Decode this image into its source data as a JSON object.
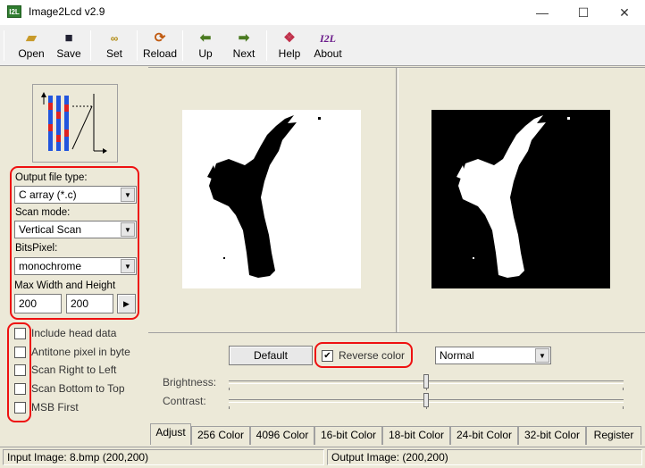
{
  "window": {
    "title": "Image2Lcd v2.9",
    "app_icon_text": "I2L",
    "minimize_glyph": "—",
    "maximize_glyph": "☐",
    "close_glyph": "✕"
  },
  "toolbar": {
    "items": [
      {
        "label": "Open",
        "icon": "folder-open-icon"
      },
      {
        "label": "Save",
        "icon": "floppy-save-icon"
      },
      {
        "label": "Set",
        "icon": "glasses-settings-icon"
      },
      {
        "label": "Reload",
        "icon": "reload-icon"
      },
      {
        "label": "Up",
        "icon": "arrow-left-icon"
      },
      {
        "label": "Next",
        "icon": "arrow-right-icon"
      },
      {
        "label": "Help",
        "icon": "help-book-icon"
      },
      {
        "label": "About",
        "icon": "i2l-logo-icon"
      }
    ],
    "about_icon_text": "I2L"
  },
  "left_panel": {
    "output_file_type_label": "Output file type:",
    "output_file_type_value": "C array (*.c)",
    "scan_mode_label": "Scan mode:",
    "scan_mode_value": "Vertical Scan",
    "bits_pixel_label": "BitsPixel:",
    "bits_pixel_value": "monochrome",
    "max_size_label": "Max Width and Height",
    "max_width": "200",
    "max_height": "200",
    "apply_glyph": "▶",
    "checkboxes": [
      {
        "label": "Include head data",
        "checked": false
      },
      {
        "label": "Antitone pixel in byte",
        "checked": false
      },
      {
        "label": "Scan Right to Left",
        "checked": false
      },
      {
        "label": "Scan Bottom to Top",
        "checked": false
      },
      {
        "label": "MSB First",
        "checked": false
      }
    ]
  },
  "adjust": {
    "default_button": "Default",
    "reverse_color_label": "Reverse color",
    "reverse_color_checked": true,
    "check_glyph": "✔",
    "mode_value": "Normal",
    "brightness_label": "Brightness:",
    "contrast_label": "Contrast:",
    "brightness_level": 0.5,
    "contrast_level": 0.5
  },
  "tabs": [
    "Adjust",
    "256 Color",
    "4096 Color",
    "16-bit Color",
    "18-bit Color",
    "24-bit Color",
    "32-bit Color",
    "Register"
  ],
  "active_tab": "Adjust",
  "status": {
    "input": "Input Image: 8.bmp (200,200)",
    "output": "Output Image: (200,200)"
  },
  "colors": {
    "highlight_red": "#ee1111",
    "input_bg": "#ffffff",
    "output_bg": "#000000",
    "bar_blue": "#2255dd",
    "bar_red": "#dd2222"
  }
}
